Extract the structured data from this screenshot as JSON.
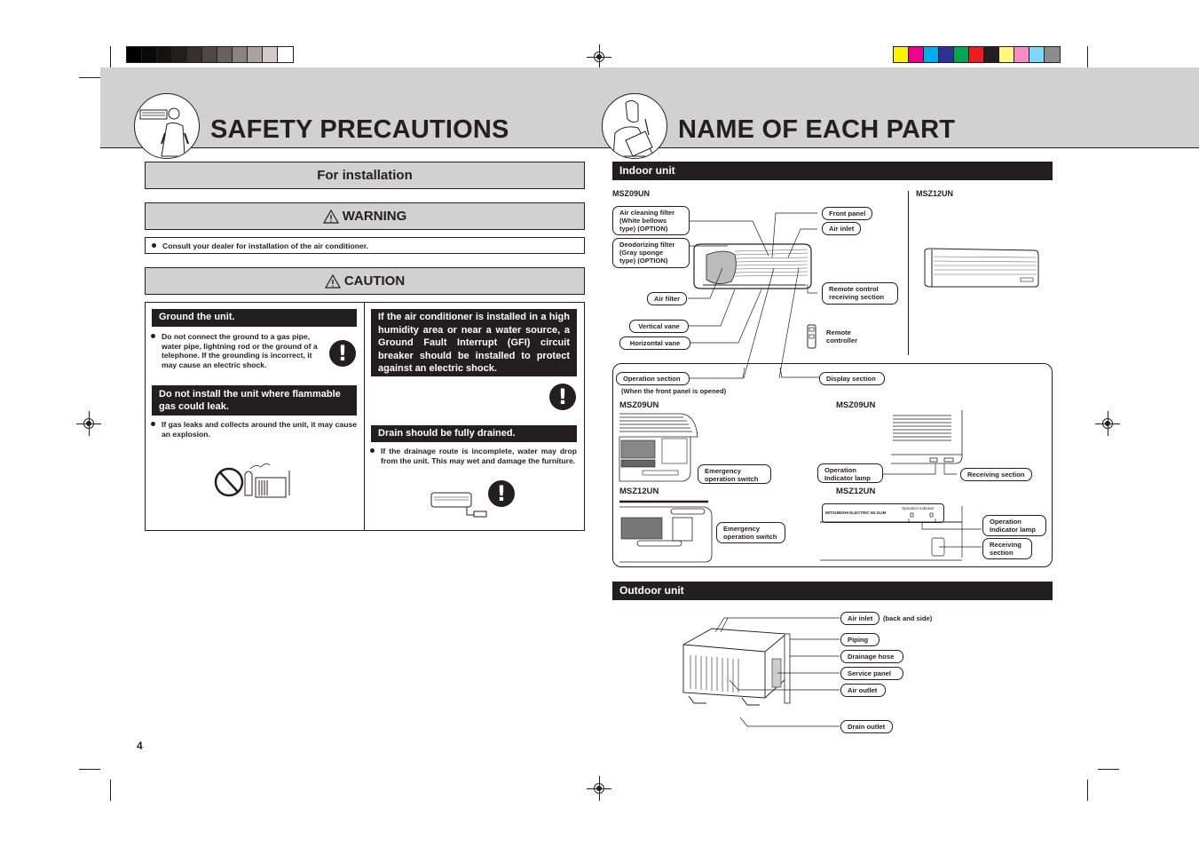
{
  "print_marks": {
    "gray_swatches": [
      "#000000",
      "#0a0a0a",
      "#151212",
      "#211e1c",
      "#363030",
      "#504846",
      "#6a615e",
      "#8a8280",
      "#aaa2a0",
      "#d3cbca",
      "#ffffff"
    ],
    "color_swatches": [
      "#fff200",
      "#ec008c",
      "#00aeef",
      "#2e3192",
      "#00a651",
      "#ed1c24",
      "#231f20",
      "#fff57f",
      "#f68bc8",
      "#7fd6f7",
      "#8c8c8c"
    ]
  },
  "left_page": {
    "title": "SAFETY PRECAUTIONS",
    "for_installation": "For installation",
    "warning": {
      "icon": "warning-triangle-icon",
      "label": "WARNING",
      "items": [
        "Consult your dealer for installation of the air conditioner."
      ]
    },
    "caution": {
      "icon": "warning-triangle-icon",
      "label": "CAUTION",
      "left_column": [
        {
          "heading": "Ground the unit.",
          "text": "Do not connect the ground to a gas pipe, water pipe, lightning rod or the ground of a telephone. If the grounding is incorrect, it may cause an electric shock."
        },
        {
          "heading": "Do not install the unit where flammable gas could leak.",
          "text": "If gas leaks and collects around the unit, it may cause an explosion."
        }
      ],
      "right_column": [
        {
          "heading": "If the air conditioner is installed in a high humidity area or near a water source, a Ground Fault Interrupt (GFI) circuit breaker should be installed to protect against an electric shock."
        },
        {
          "heading": "Drain should be fully drained.",
          "text": "If the drainage route is incomplete, water may drop from the unit. This may wet and damage the furniture."
        }
      ]
    },
    "page_number": "4"
  },
  "right_page": {
    "title": "NAME OF EACH PART",
    "indoor": {
      "heading": "Indoor unit",
      "model_a": "MSZ09UN",
      "model_b": "MSZ12UN",
      "labels": {
        "air_cleaning_filter": [
          "Air cleaning filter",
          "(White bellows",
          "type) (OPTION)"
        ],
        "deodorizing_filter": [
          "Deodorizing filter",
          "(Gray sponge",
          "type) (OPTION)"
        ],
        "air_filter": "Air filter",
        "vertical_vane": "Vertical vane",
        "horizontal_vane": "Horizontal vane",
        "front_panel": "Front panel",
        "air_inlet": "Air inlet",
        "remote_receiving": [
          "Remote control",
          "receiving section"
        ],
        "remote_controller": [
          "Remote",
          "controller"
        ]
      },
      "detail": {
        "operation_section": "Operation section",
        "operation_note": "(When the front panel is opened)",
        "display_section": "Display section",
        "model_a": "MSZ09UN",
        "model_b": "MSZ12UN",
        "emergency_switch": [
          "Emergency",
          "operation switch"
        ],
        "operation_lamp": [
          "Operation",
          "Indicator lamp"
        ],
        "receiving_section": "Receiving section",
        "receiving_section_b": [
          "Receiving",
          "section"
        ],
        "operation_indicator_text": "Operation Indicator",
        "brand_text": "MITSUBISHI ELECTRIC  Mr.SLIM"
      }
    },
    "outdoor": {
      "heading": "Outdoor unit",
      "labels": {
        "air_inlet": "Air inlet",
        "air_inlet_note": "(back and side)",
        "piping": "Piping",
        "drainage_hose": "Drainage hose",
        "service_panel": "Service panel",
        "air_outlet": "Air outlet",
        "drain_outlet": "Drain outlet"
      }
    }
  }
}
